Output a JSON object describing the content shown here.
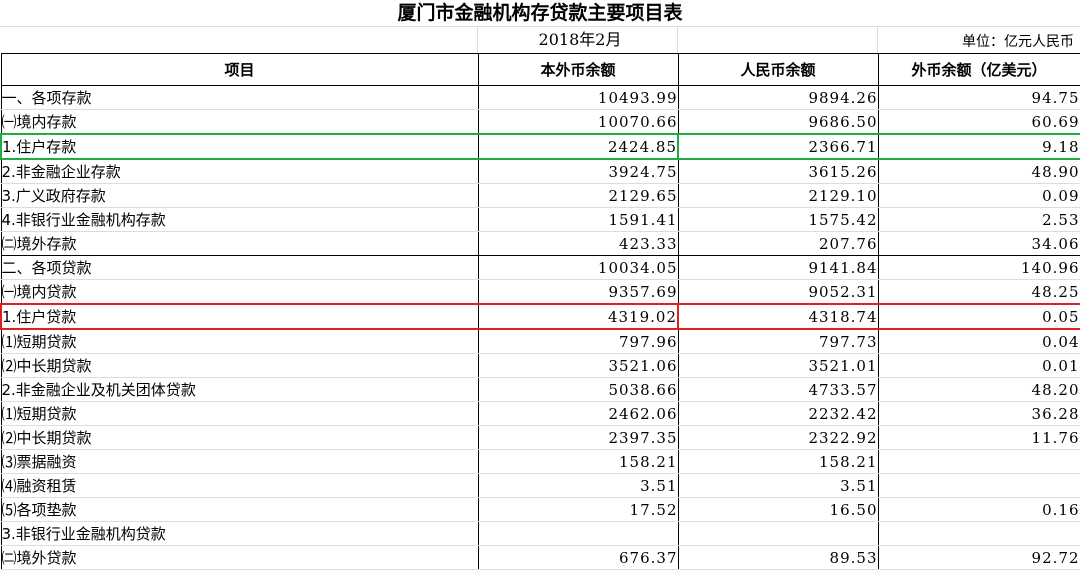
{
  "title": "厦门市金融机构存贷款主要项目表",
  "date": "2018年2月",
  "unit": "单位：亿元人民币",
  "headers": [
    "项目",
    "本外币余额",
    "人民币余额",
    "外币余额（亿美元）"
  ],
  "rows": [
    {
      "name": "一、各项存款",
      "total": "10493.99",
      "rmb": "9894.26",
      "fx": "94.75"
    },
    {
      "name": "㈠境内存款",
      "total": "10070.66",
      "rmb": "9686.50",
      "fx": "60.69"
    },
    {
      "name": "1.住户存款",
      "total": "2424.85",
      "rmb": "2366.71",
      "fx": "9.18"
    },
    {
      "name": "2.非金融企业存款",
      "total": "3924.75",
      "rmb": "3615.26",
      "fx": "48.90"
    },
    {
      "name": "3.广义政府存款",
      "total": "2129.65",
      "rmb": "2129.10",
      "fx": "0.09"
    },
    {
      "name": "4.非银行业金融机构存款",
      "total": "1591.41",
      "rmb": "1575.42",
      "fx": "2.53"
    },
    {
      "name": "㈡境外存款",
      "total": "423.33",
      "rmb": "207.76",
      "fx": "34.06"
    },
    {
      "name": "二、各项贷款",
      "total": "10034.05",
      "rmb": "9141.84",
      "fx": "140.96"
    },
    {
      "name": "㈠境内贷款",
      "total": "9357.69",
      "rmb": "9052.31",
      "fx": "48.25"
    },
    {
      "name": "1.住户贷款",
      "total": "4319.02",
      "rmb": "4318.74",
      "fx": "0.05"
    },
    {
      "name": "⑴短期贷款",
      "total": "797.96",
      "rmb": "797.73",
      "fx": "0.04"
    },
    {
      "name": "⑵中长期贷款",
      "total": "3521.06",
      "rmb": "3521.01",
      "fx": "0.01"
    },
    {
      "name": "2.非金融企业及机关团体贷款",
      "total": "5038.66",
      "rmb": "4733.57",
      "fx": "48.20"
    },
    {
      "name": "⑴短期贷款",
      "total": "2462.06",
      "rmb": "2232.42",
      "fx": "36.28"
    },
    {
      "name": "⑵中长期贷款",
      "total": "2397.35",
      "rmb": "2322.92",
      "fx": "11.76"
    },
    {
      "name": "⑶票据融资",
      "total": "158.21",
      "rmb": "158.21",
      "fx": ""
    },
    {
      "name": "⑷融资租赁",
      "total": "3.51",
      "rmb": "3.51",
      "fx": ""
    },
    {
      "name": "⑸各项垫款",
      "total": "17.52",
      "rmb": "16.50",
      "fx": "0.16"
    },
    {
      "name": "3.非银行业金融机构贷款",
      "total": "",
      "rmb": "",
      "fx": ""
    },
    {
      "name": "㈡境外贷款",
      "total": "676.37",
      "rmb": "89.53",
      "fx": "92.72"
    }
  ],
  "highlights": {
    "green": "1.住户存款",
    "red": "1.住户贷款",
    "green_color": "#22aa44",
    "red_color": "#e02020"
  }
}
